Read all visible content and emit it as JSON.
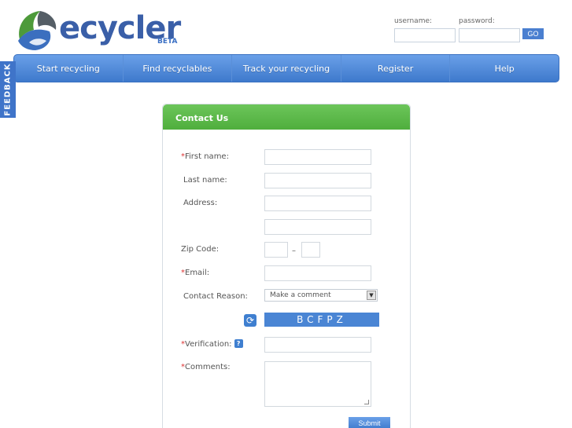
{
  "logo": {
    "text": "ecycler",
    "beta": "BETA"
  },
  "login": {
    "username_label": "username:",
    "password_label": "password:",
    "go_label": "GO"
  },
  "nav": {
    "items": [
      {
        "label": "Start recycling"
      },
      {
        "label": "Find recyclables"
      },
      {
        "label": "Track your recycling"
      },
      {
        "label": "Register"
      },
      {
        "label": "Help"
      }
    ]
  },
  "feedback": {
    "label": "FEEDBACK"
  },
  "form": {
    "title": "Contact Us",
    "required_mark": "*",
    "first_name_label": "First name:",
    "last_name_label": "Last name:",
    "address_label": "Address:",
    "zip_label": "Zip Code:",
    "zip_separator": "–",
    "email_label": "Email:",
    "reason_label": "Contact Reason:",
    "reason_selected": "Make a comment",
    "captcha_text": "BCFPZ",
    "verification_label": "Verification:",
    "help_icon_label": "?",
    "comments_label": "Comments:",
    "submit_label": "Submit"
  },
  "colors": {
    "brand_blue": "#3e79cc",
    "header_green": "#4fae3d",
    "required_red": "#d33333"
  }
}
